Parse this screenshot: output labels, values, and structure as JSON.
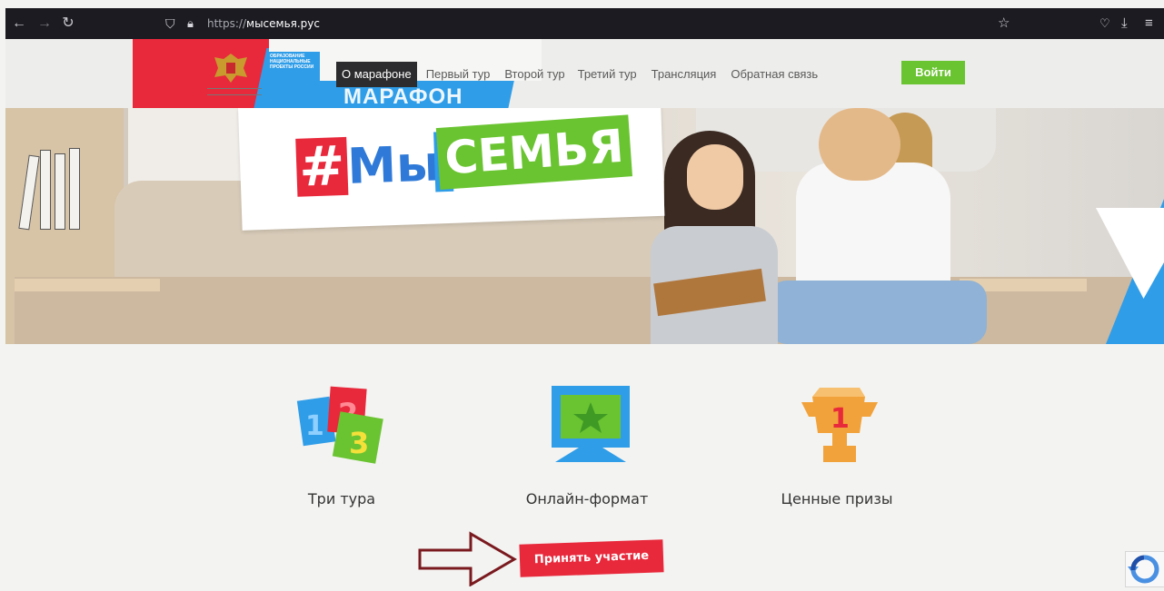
{
  "browser": {
    "url_protocol": "https://",
    "url_host": "мысемья.рус"
  },
  "header": {
    "hero_watermark": "МАРАФОН",
    "np_logo": "ОБРАЗОВАНИЕ НАЦИОНАЛЬНЫЕ ПРОЕКТЫ РОССИИ",
    "menu": [
      {
        "label": "О марафоне",
        "active": true
      },
      {
        "label": "Первый тур",
        "active": false
      },
      {
        "label": "Второй тур",
        "active": false
      },
      {
        "label": "Третий тур",
        "active": false
      },
      {
        "label": "Трансляция",
        "active": false
      },
      {
        "label": "Обратная связь",
        "active": false
      }
    ],
    "login_label": "Войти"
  },
  "hero": {
    "logo_hash": "#",
    "logo_my": "Мы",
    "logo_semya": "СЕМЬЯ"
  },
  "features": {
    "items": [
      {
        "label": "Три тура",
        "icon": "numbers-123-icon"
      },
      {
        "label": "Онлайн-формат",
        "icon": "monitor-star-icon"
      },
      {
        "label": "Ценные призы",
        "icon": "trophy-icon"
      }
    ],
    "cta_label": "Принять участие"
  },
  "colors": {
    "red": "#e8283b",
    "blue": "#2f9de8",
    "green": "#6ac431",
    "dark_menu": "#2c2c2e"
  }
}
